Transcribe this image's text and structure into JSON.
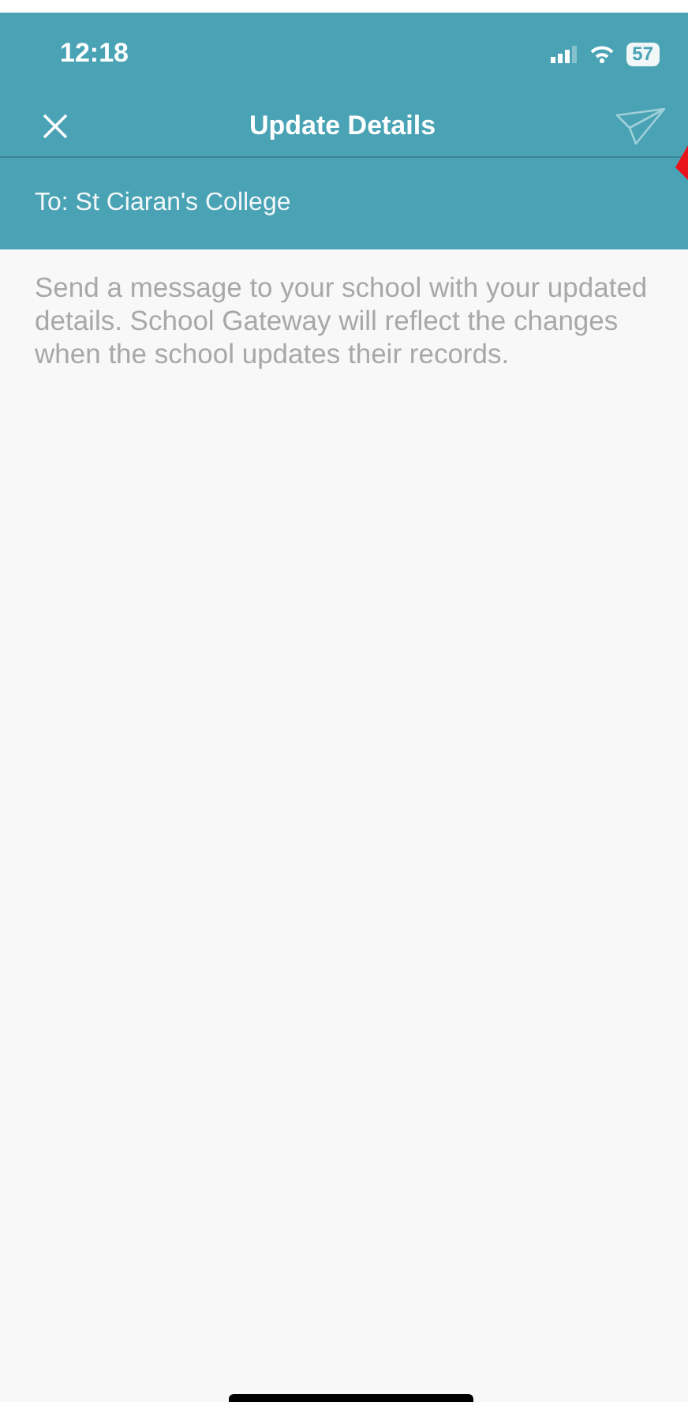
{
  "status_bar": {
    "time": "12:18",
    "battery": "57"
  },
  "nav": {
    "title": "Update Details",
    "send_disabled": true
  },
  "recipient": "To: St Ciaran's College",
  "message": {
    "placeholder": "Send a message to your school with your updated details. School Gateway will reflect the changes when the school updates their records."
  }
}
